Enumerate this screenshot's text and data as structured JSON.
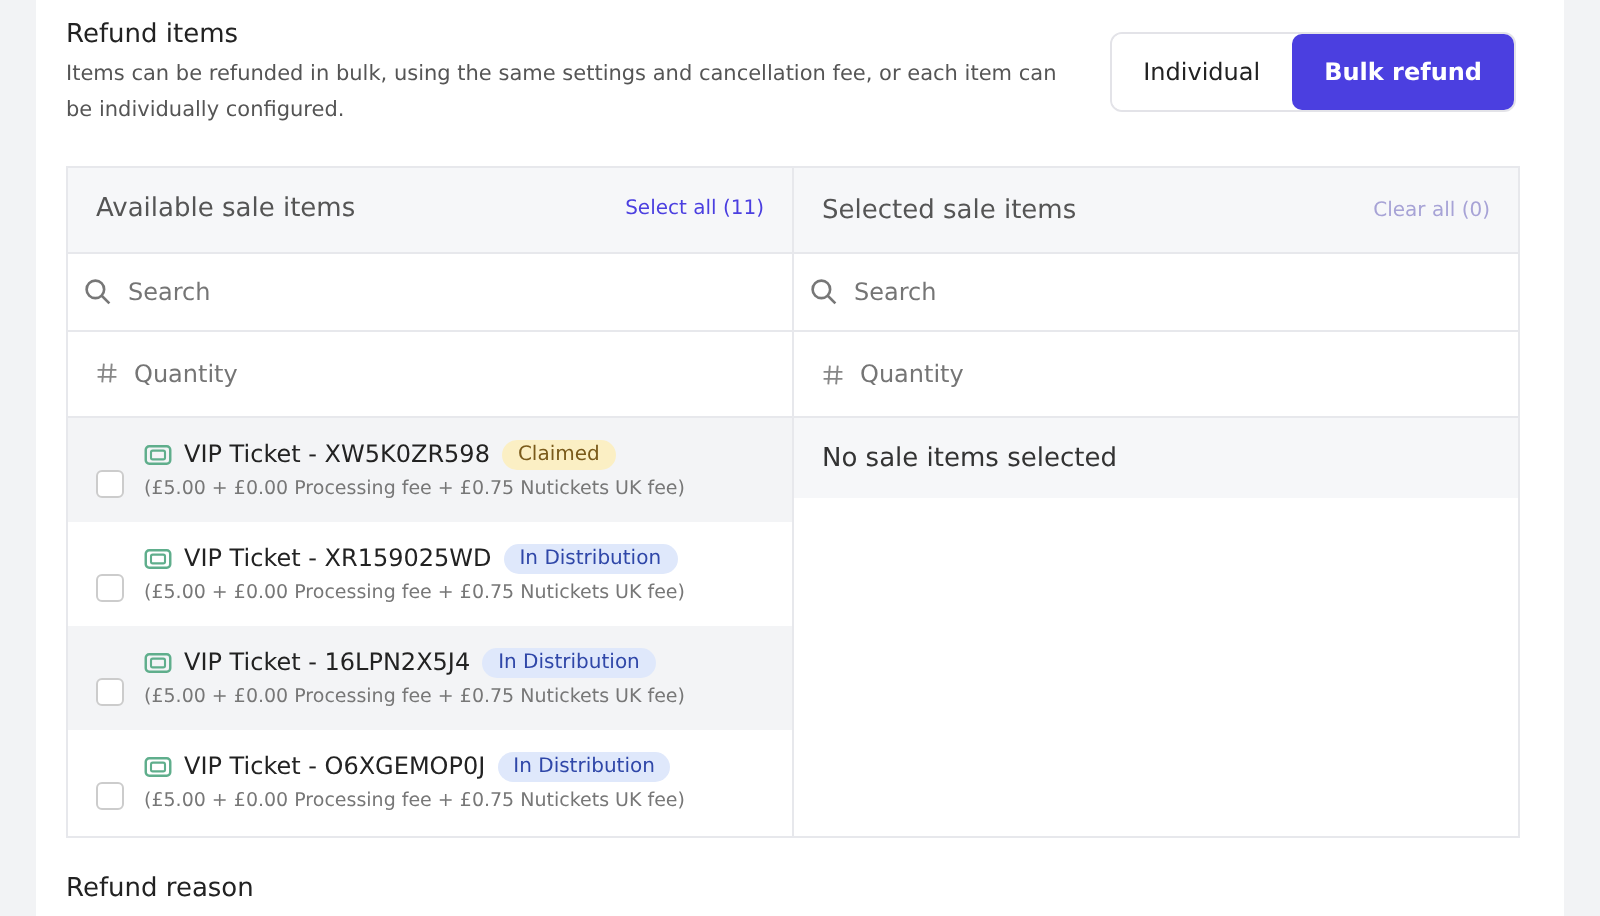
{
  "section": {
    "title": "Refund items",
    "description": "Items can be refunded in bulk, using the same settings and cancellation fee, or each item can be individually configured."
  },
  "mode_toggle": [
    {
      "label": "Individual",
      "selected": false
    },
    {
      "label": "Bulk refund",
      "selected": true
    }
  ],
  "available": {
    "title": "Available sale items",
    "action": "Select all (11)",
    "search": {
      "placeholder": "Search"
    },
    "quantity": {
      "placeholder": "Quantity"
    },
    "items": [
      {
        "name": "VIP Ticket - XW5K0ZR598",
        "status": "Claimed",
        "kind": "claimed",
        "price": "(£5.00 + £0.00 Processing fee + £0.75 Nutickets UK fee)",
        "checked": false,
        "highlighted": true
      },
      {
        "name": "VIP Ticket - XR159025WD",
        "status": "In Distribution",
        "kind": "distribution",
        "price": "(£5.00 + £0.00 Processing fee + £0.75 Nutickets UK fee)",
        "checked": false,
        "highlighted": false
      },
      {
        "name": "VIP Ticket - 16LPN2X5J4",
        "status": "In Distribution",
        "kind": "distribution",
        "price": "(£5.00 + £0.00 Processing fee + £0.75 Nutickets UK fee)",
        "checked": false,
        "highlighted": true
      },
      {
        "name": "VIP Ticket - O6XGEMOP0J",
        "status": "In Distribution",
        "kind": "distribution",
        "price": "(£5.00 + £0.00 Processing fee + £0.75 Nutickets UK fee)",
        "checked": false,
        "highlighted": false
      }
    ]
  },
  "selected": {
    "title": "Selected sale items",
    "action": "Clear all (0)",
    "search": {
      "placeholder": "Search"
    },
    "quantity": {
      "placeholder": "Quantity"
    },
    "empty_message": "No sale items selected"
  },
  "next_section": {
    "title": "Refund reason"
  }
}
